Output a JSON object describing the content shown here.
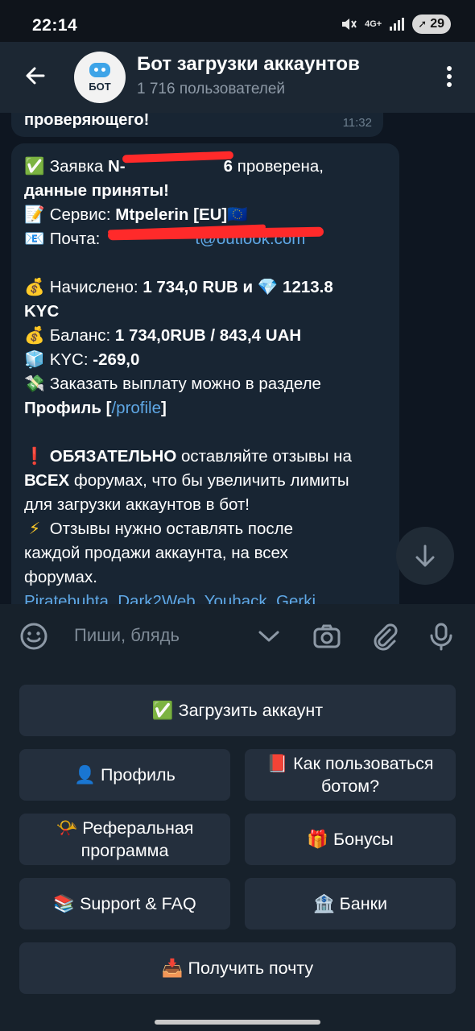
{
  "status": {
    "time": "22:14",
    "network": "4G+",
    "battery": "29"
  },
  "header": {
    "title": "Бот загрузки аккаунтов",
    "subtitle": "1 716 пользователей",
    "avatar_text": "БОТ"
  },
  "prev_message": {
    "text": "проверяющего!",
    "time": "11:32"
  },
  "message": {
    "l1": {
      "emoji": "✅",
      "a": " Заявка ",
      "b": "N-",
      "tail": "6",
      "c": " проверена,"
    },
    "l2": {
      "text": "данные приняты!"
    },
    "l3": {
      "emoji": "📝",
      "a": " Сервис: ",
      "b": "Mtpelerin [EU]",
      "flag": "🇪🇺"
    },
    "l4": {
      "emoji": "📧",
      "a": " Почта:",
      "link": "t@outlook.com"
    },
    "l6": {
      "emoji": "💰",
      "a": " Начислено: ",
      "b": "1 734,0 RUB и ",
      "gem": "💎",
      "c": " 1213.8"
    },
    "l7": {
      "text": "KYC"
    },
    "l8": {
      "emoji": "💰",
      "a": " Баланс: ",
      "b": "1 734,0RUB  / 843,4 UAH"
    },
    "l9": {
      "emoji": "🧊",
      "a": " KYC: ",
      "b": "-269,0"
    },
    "l10": {
      "emoji": "💸",
      "a": " Заказать выплату можно в разделе"
    },
    "l11": {
      "b": "Профиль [",
      "link": "/profile",
      "c": "]"
    },
    "l13": {
      "emoji": "❗",
      "b": " ОБЯЗАТЕЛЬНО",
      "a": " оставляйте отзывы на"
    },
    "l14": {
      "b": "ВСЕХ",
      "a": " форумах, что бы увеличить лимиты"
    },
    "l15": {
      "text": "для загрузки аккаунтов в бот!"
    },
    "l16": {
      "emoji": "⚡",
      "a": " Отзывы нужно оставлять после"
    },
    "l17": {
      "text": "каждой продажи аккаунта, на всех"
    },
    "l18": {
      "text": "форумах."
    },
    "l19": {
      "link": "Piratebuhta, Dark2Web, Youhack, Gerki"
    }
  },
  "input": {
    "placeholder": "Пиши, блядь"
  },
  "keyboard": {
    "upload": "✅ Загрузить аккаунт",
    "profile": "👤 Профиль",
    "howto_line1": "📕 Как пользоваться",
    "howto_line2": "ботом?",
    "referral_line1": "📯 Реферальная",
    "referral_line2": "программа",
    "bonuses": "🎁 Бонусы",
    "support": "📚 Support & FAQ",
    "banks": "🏦 Банки",
    "mail": "📥 Получить почту"
  },
  "colors": {
    "bg": "#0e1621",
    "bubble": "#182533",
    "header": "#1c2733",
    "button": "#242f3d",
    "link": "#5fa8e6",
    "redaction": "#ff2a2a"
  }
}
